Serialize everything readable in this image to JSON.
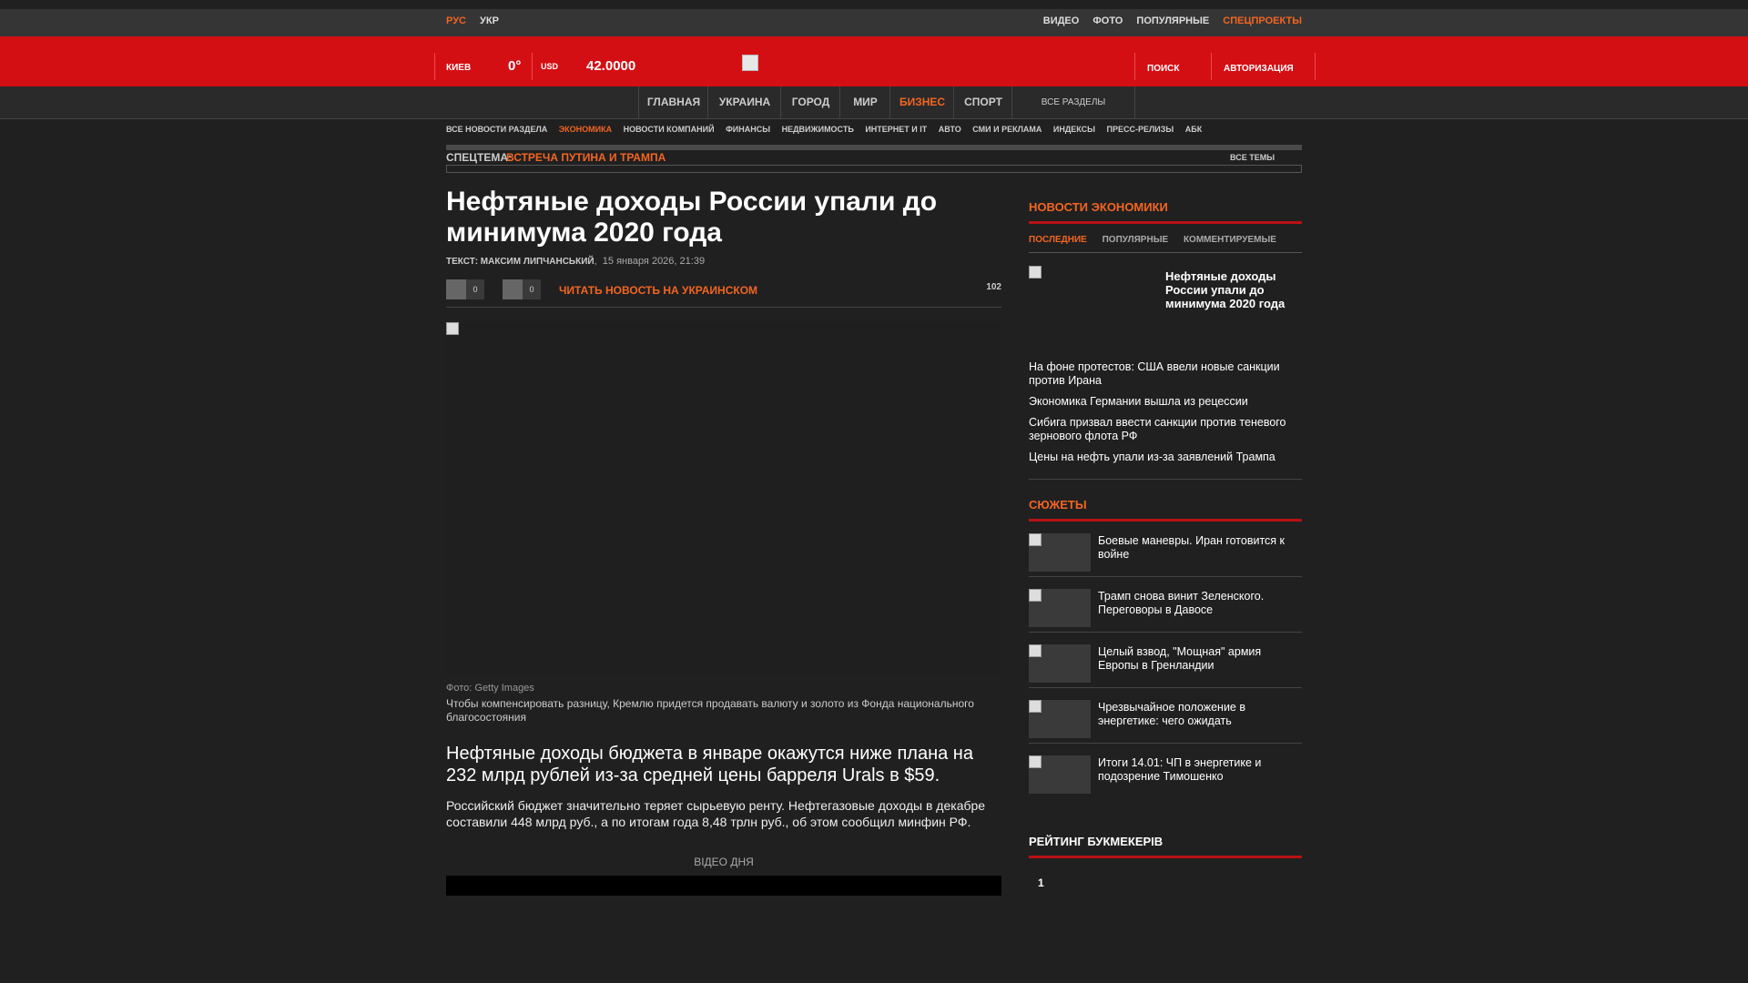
{
  "topbar": {
    "lang_ru": "РУС",
    "lang_uk": "УКР",
    "links": [
      "ВИДЕО",
      "ФОТО",
      "ПОПУЛЯРНЫЕ"
    ],
    "special": "СПЕЦПРОЕКТЫ"
  },
  "header": {
    "city": "КИЕВ",
    "temp": "0°",
    "currency": "USD",
    "rate": "42.0000",
    "search": "ПОИСК",
    "login": "АВТОРИЗАЦИЯ"
  },
  "nav": {
    "items": [
      "ГЛАВНАЯ",
      "УКРАИНА",
      "ГОРОД",
      "МИР",
      "БИЗНЕС",
      "СПОРТ"
    ],
    "all_sections": "ВСЕ РАЗДЕЛЫ"
  },
  "subnav": {
    "items": [
      "ВСЕ НОВОСТИ РАЗДЕЛА",
      "ЭКОНОМИКА",
      "НОВОСТИ КОМПАНИЙ",
      "ФИНАНСЫ",
      "НЕДВИЖИМОСТЬ",
      "ИНТЕРНЕТ И IT",
      "АВТО",
      "СМИ И РЕКЛАМА",
      "ИНДЕКСЫ",
      "ПРЕСС-РЕЛИЗЫ",
      "АБК"
    ]
  },
  "spectopic": {
    "label": "СПЕЦТЕМА:",
    "topic": "ВСТРЕЧА ПУТИНА И ТРАМПА",
    "all": "ВСЕ ТЕМЫ"
  },
  "article": {
    "headline": "Нефтяные доходы России упали до минимума 2020 года",
    "author_label": "ТЕКСТ: МАКСИМ ЛИПЧАНСЬКИЙ",
    "date": "15 января 2026, 21:39",
    "count1": "0",
    "count2": "0",
    "read_ua": "ЧИТАТЬ НОВОСТЬ НА УКРАИНСКОМ",
    "views": "102",
    "photo_credit": "Фото: Getty Images",
    "caption": "Чтобы компенсировать разницу, Кремлю придется продавать валюту и золото из Фонда национального благосостояния",
    "lead": "Нефтяные доходы бюджета в январе окажутся ниже плана на 232 млрд рублей из-за средней цены барреля Urals в $59.",
    "body": "Российский бюджет значительно теряет сырьевую ренту. Нефтегазовые доходы в декабре составили 448 млрд руб., а по итогам года 8,48 трлн руб., об этом сообщил минфин РФ.",
    "video_label": "ВІДЕО ДНЯ"
  },
  "sidebar": {
    "econ_title": "НОВОСТИ ЭКОНОМИКИ",
    "tabs": [
      "ПОСЛЕДНИЕ",
      "ПОПУЛЯРНЫЕ",
      "КОММЕНТИРУЕМЫЕ"
    ],
    "featured_title": "Нефтяные доходы России упали до минимума 2020 года",
    "news": [
      "На фоне протестов: США ввели новые санкции против Ирана",
      "Экономика Германии вышла из рецессии",
      "Сибига призвал ввести санкции против теневого зернового флота РФ",
      "Цены на нефть упали из-за заявлений Трампа"
    ],
    "stories_title": "СЮЖЕТЫ",
    "stories": [
      "Боевые маневры. Иран готовится к войне",
      "Трамп снова винит Зеленского. Переговоры в Давосе",
      "Целый взвод, \"Мощная\" армия Европы в Гренландии",
      "Чрезвычайное положение в энергетике: чего ожидать",
      "Итоги 14.01: ЧП в энергетике и подозрение Тимошенко"
    ],
    "rating_title": "РЕЙТИНГ БУКМЕКЕРІВ",
    "rating_first": "1"
  },
  "colors": {
    "accent": "#f26522",
    "brand_red": "#d40f14",
    "background": "#202020"
  }
}
